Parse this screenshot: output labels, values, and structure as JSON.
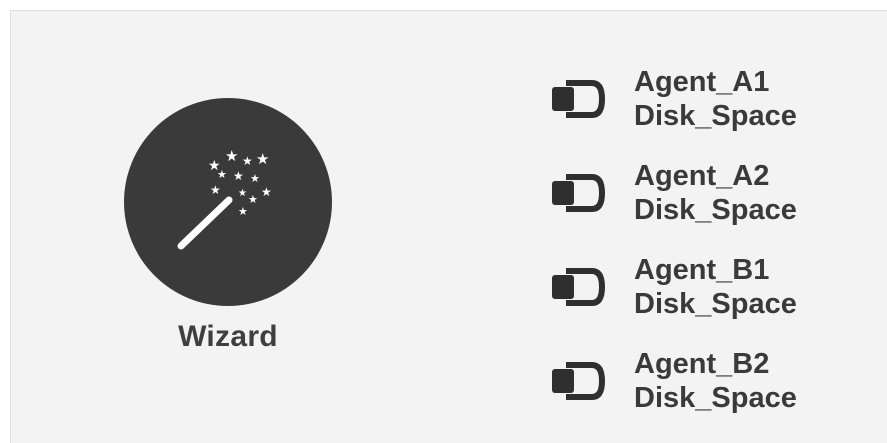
{
  "wizard": {
    "label": "Wizard",
    "icon": "magic-wand-icon"
  },
  "agents": [
    {
      "name": "Agent_A1",
      "metric": "Disk_Space",
      "icon": "connector-icon"
    },
    {
      "name": "Agent_A2",
      "metric": "Disk_Space",
      "icon": "connector-icon"
    },
    {
      "name": "Agent_B1",
      "metric": "Disk_Space",
      "icon": "connector-icon"
    },
    {
      "name": "Agent_B2",
      "metric": "Disk_Space",
      "icon": "connector-icon"
    }
  ],
  "colors": {
    "circle": "#3a3a3a",
    "text": "#3a3a3a",
    "panel": "#f3f3f3"
  }
}
